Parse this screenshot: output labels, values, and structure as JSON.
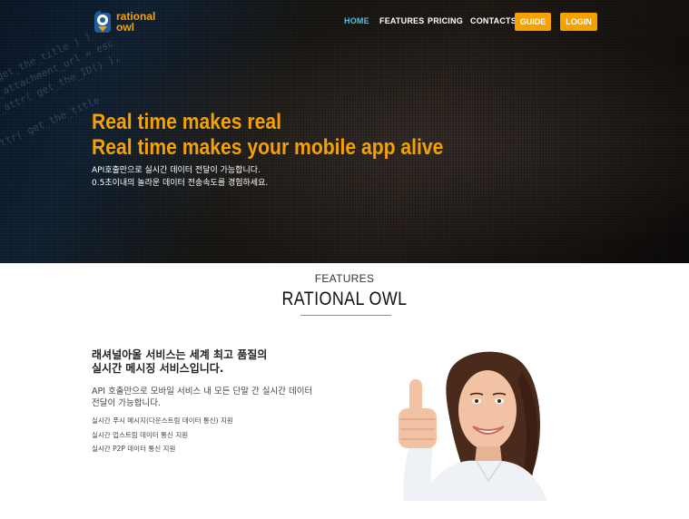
{
  "brand": {
    "logo_text_line1": "rational",
    "logo_text_line2": "owl",
    "accent_color": "#f6a100",
    "active_link_color": "#4fc2df"
  },
  "nav": {
    "links": [
      "HOME",
      "FEATURES",
      "PRICING",
      "CONTACTS"
    ],
    "active": "HOME",
    "guide_button": "GUIDE",
    "login_button": "LOGIN"
  },
  "hero": {
    "title_line1": "Real time makes real",
    "title_line2": "Real time makes your mobile app alive",
    "sub_line1": "API호출만으로 실시간 데이터 전달이 가능합니다.",
    "sub_line2": "0.5초이내의 놀라운 데이터 전송속도를 경험하세요."
  },
  "features": {
    "kicker": "FEATURES",
    "title": "RATIONAL OWL",
    "heading_line1": "래셔널아울 서비스는 세계 최고 품질의",
    "heading_line2": "실시간 메시징 서비스입니다.",
    "desc_line1": "API 호출만으로 모바일 서비스 내 모든 단말 간 실시간 데이터",
    "desc_line2": "전달이 가능합니다.",
    "items": [
      "실시간 푸시 메시지(다운스트림 데이터 통신) 지원",
      "실시간 업스트림 데이터 통신 지원",
      "실시간 P2P 데이터 통신 지원"
    ]
  }
}
